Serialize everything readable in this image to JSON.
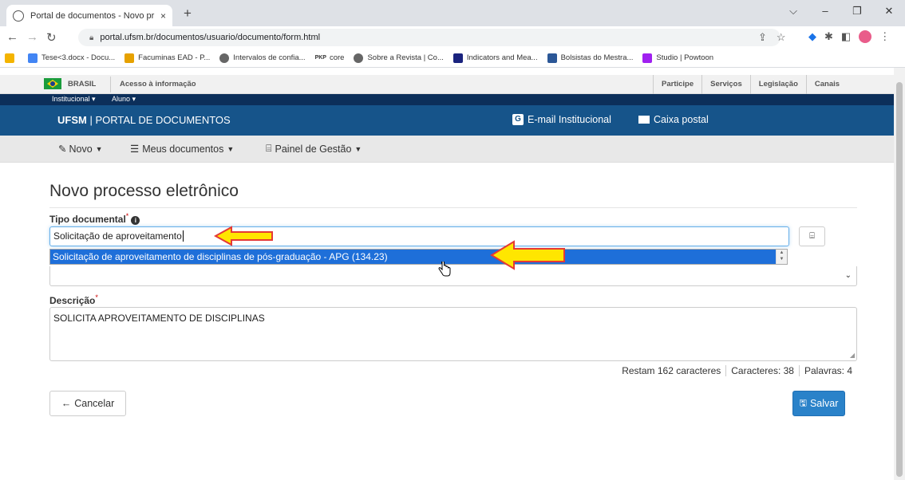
{
  "browser": {
    "tab_title": "Portal de documentos - Novo pr",
    "tab_close": "×",
    "new_tab": "+",
    "url": "portal.ufsm.br/documentos/usuario/documento/form.html",
    "window_controls": [
      "⌵",
      "–",
      "❐",
      "✕"
    ],
    "bookmarks": [
      {
        "label": "Tese<3.docx - Docu...",
        "color": "#4285f4"
      },
      {
        "label": "Facuminas EAD - P...",
        "color": "#e6a100"
      },
      {
        "label": "Intervalos de confia...",
        "color": "#555555"
      },
      {
        "label": "core",
        "color": "#333333"
      },
      {
        "label": "Sobre a Revista | Co...",
        "color": "#555555"
      },
      {
        "label": "Indicators and Mea...",
        "color": "#1a237e"
      },
      {
        "label": "Bolsistas do Mestra...",
        "color": "#2b5797"
      },
      {
        "label": "Studio | Powtoon",
        "color": "#a020f0"
      }
    ]
  },
  "gov": {
    "brasil": "BRASIL",
    "acesso": "Acesso à informação",
    "links": [
      "Participe",
      "Serviços",
      "Legislação",
      "Canais"
    ]
  },
  "inst": {
    "institucional": "Institucional ▾",
    "aluno": "Aluno ▾"
  },
  "portal": {
    "brand_bold": "UFSM",
    "brand_rest": " | PORTAL DE DOCUMENTOS",
    "email": "E-mail Institucional",
    "caixa": "Caixa postal"
  },
  "menu": {
    "novo": "Novo",
    "meus": "Meus documentos",
    "painel": "Painel de Gestão"
  },
  "form": {
    "title": "Novo processo eletrônico",
    "tipo_label": "Tipo documental",
    "tipo_value": "Solicitação de aproveitamento",
    "suggestion": "Solicitação de aproveitamento de disciplinas de pós-graduação - APG (134.23)",
    "descricao_label": "Descrição",
    "descricao_value": "SOLICITA APROVEITAMENTO DE DISCIPLINAS",
    "restam": "Restam 162 caracteres",
    "caracteres": "Caracteres: 38",
    "palavras": "Palavras: 4",
    "cancel": "Cancelar",
    "save": "Salvar"
  },
  "colors": {
    "portal_bar": "#16548a",
    "inst_bar": "#0c2f5a",
    "highlight": "#1e6fd9",
    "save_button": "#2a82c9",
    "arrow_fill": "#ffe600",
    "arrow_stroke": "#e53935"
  }
}
